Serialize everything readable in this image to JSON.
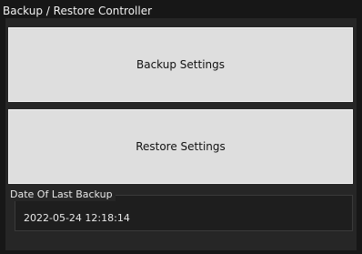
{
  "panel": {
    "title": "Backup / Restore Controller",
    "backup_button_label": "Backup Settings",
    "restore_button_label": "Restore Settings",
    "last_backup": {
      "label": "Date Of Last Backup",
      "value": "2022-05-24 12:18:14"
    }
  }
}
